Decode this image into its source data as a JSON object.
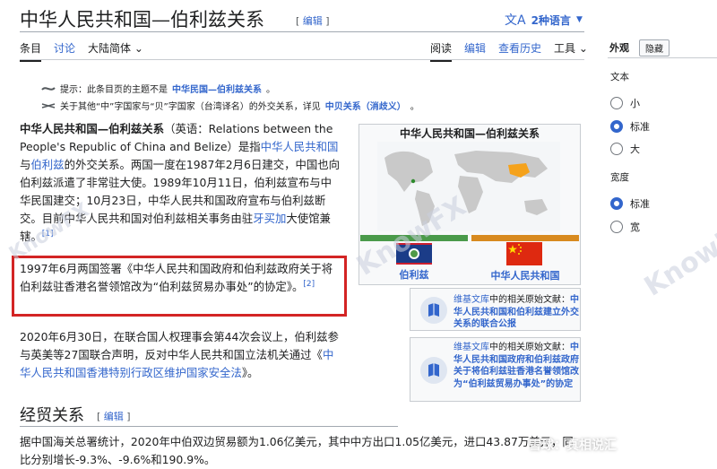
{
  "header": {
    "title": "中华人民共和国—伯利兹关系",
    "edit_label": "编辑",
    "lang_label": "2种语言"
  },
  "tabs_left": [
    {
      "label": "条目"
    },
    {
      "label": "讨论"
    }
  ],
  "variant": {
    "label": "大陆简体"
  },
  "tabs_right": [
    {
      "label": "阅读"
    },
    {
      "label": "编辑"
    },
    {
      "label": "查看历史"
    }
  ],
  "tools_label": "工具",
  "hatnotes": [
    {
      "prefix": "提示：此条目页的主题不是",
      "link": "中华民国—伯利兹关系",
      "suffix": "。"
    },
    {
      "prefix": "关于其他“中”字国家与“贝”字国家（台湾译名）的外交关系，详见",
      "link": "中贝关系（消歧义）",
      "suffix": "。"
    }
  ],
  "para1": {
    "bold_title": "中华人民共和国—伯利兹关系",
    "t1": "（英语：Relations between the People's Republic of China and Belize）是指",
    "link1": "中华人民共和国",
    "t2": "与",
    "link2": "伯利兹",
    "t3": "的外交关系。两国一度在1987年2月6日建交，中国也向伯利兹派遣了非常驻大使。1989年10月11日，伯利兹宣布与中华民国建交；10月23日，中华人民共和国政府宣布与伯利兹断交。目前中华人民共和国对伯利兹相关事务由驻",
    "link3": "牙买加",
    "t4": "大使馆兼辖。",
    "ref": "[1]"
  },
  "para2": {
    "text": "1997年6月两国签署《中华人民共和国政府和伯利兹政府关于将伯利兹驻香港名誉领馆改为“伯利兹贸易办事处”的协定》。",
    "ref": "[2]"
  },
  "para3": {
    "t1": "2020年6月30日，在联合国人权理事会第44次会议上，伯利兹参与英美等27国联合声明，反对中华人民共和国立法机关通过《",
    "link": "中华人民共和国香港特别行政区维护国家安全法",
    "t2": "》。"
  },
  "infobox": {
    "title": "中华人民共和国—伯利兹关系",
    "left_label": "伯利兹",
    "right_label": "中华人民共和国",
    "left_color": "#4a9a4a",
    "right_color": "#d88a1f"
  },
  "wikisource": [
    {
      "prefix": "维基文库",
      "middle": "中的相关原始文献：",
      "link": "中华人民共和国和伯利兹建立外交关系的联合公报"
    },
    {
      "prefix": "维基文库",
      "middle": "中的相关原始文献：",
      "link": "中华人民共和国政府和伯利兹政府关于将伯利兹驻香港名誉领馆改为“伯利兹贸易办事处”的协定"
    }
  ],
  "section": {
    "heading": "经贸关系",
    "edit_label": "编辑",
    "text1": "据中国海关总署统计，2020年中伯双边贸易额为1.06亿美元，其中中方出口1.05亿美元，进口43.87万美元，同",
    "text2": "比分别增长-9.3%、-9.6%和190.9%。"
  },
  "sidebar": {
    "appearance": "外观",
    "hide": "隐藏",
    "text_label": "文本",
    "text_options": [
      "小",
      "标准",
      "大"
    ],
    "text_selected": "标准",
    "width_label": "宽度",
    "width_options": [
      "标准",
      "宽"
    ],
    "width_selected": "标准"
  },
  "watermarks": {
    "brand": "KnowFX",
    "footer": "雪球：真相说汇"
  }
}
